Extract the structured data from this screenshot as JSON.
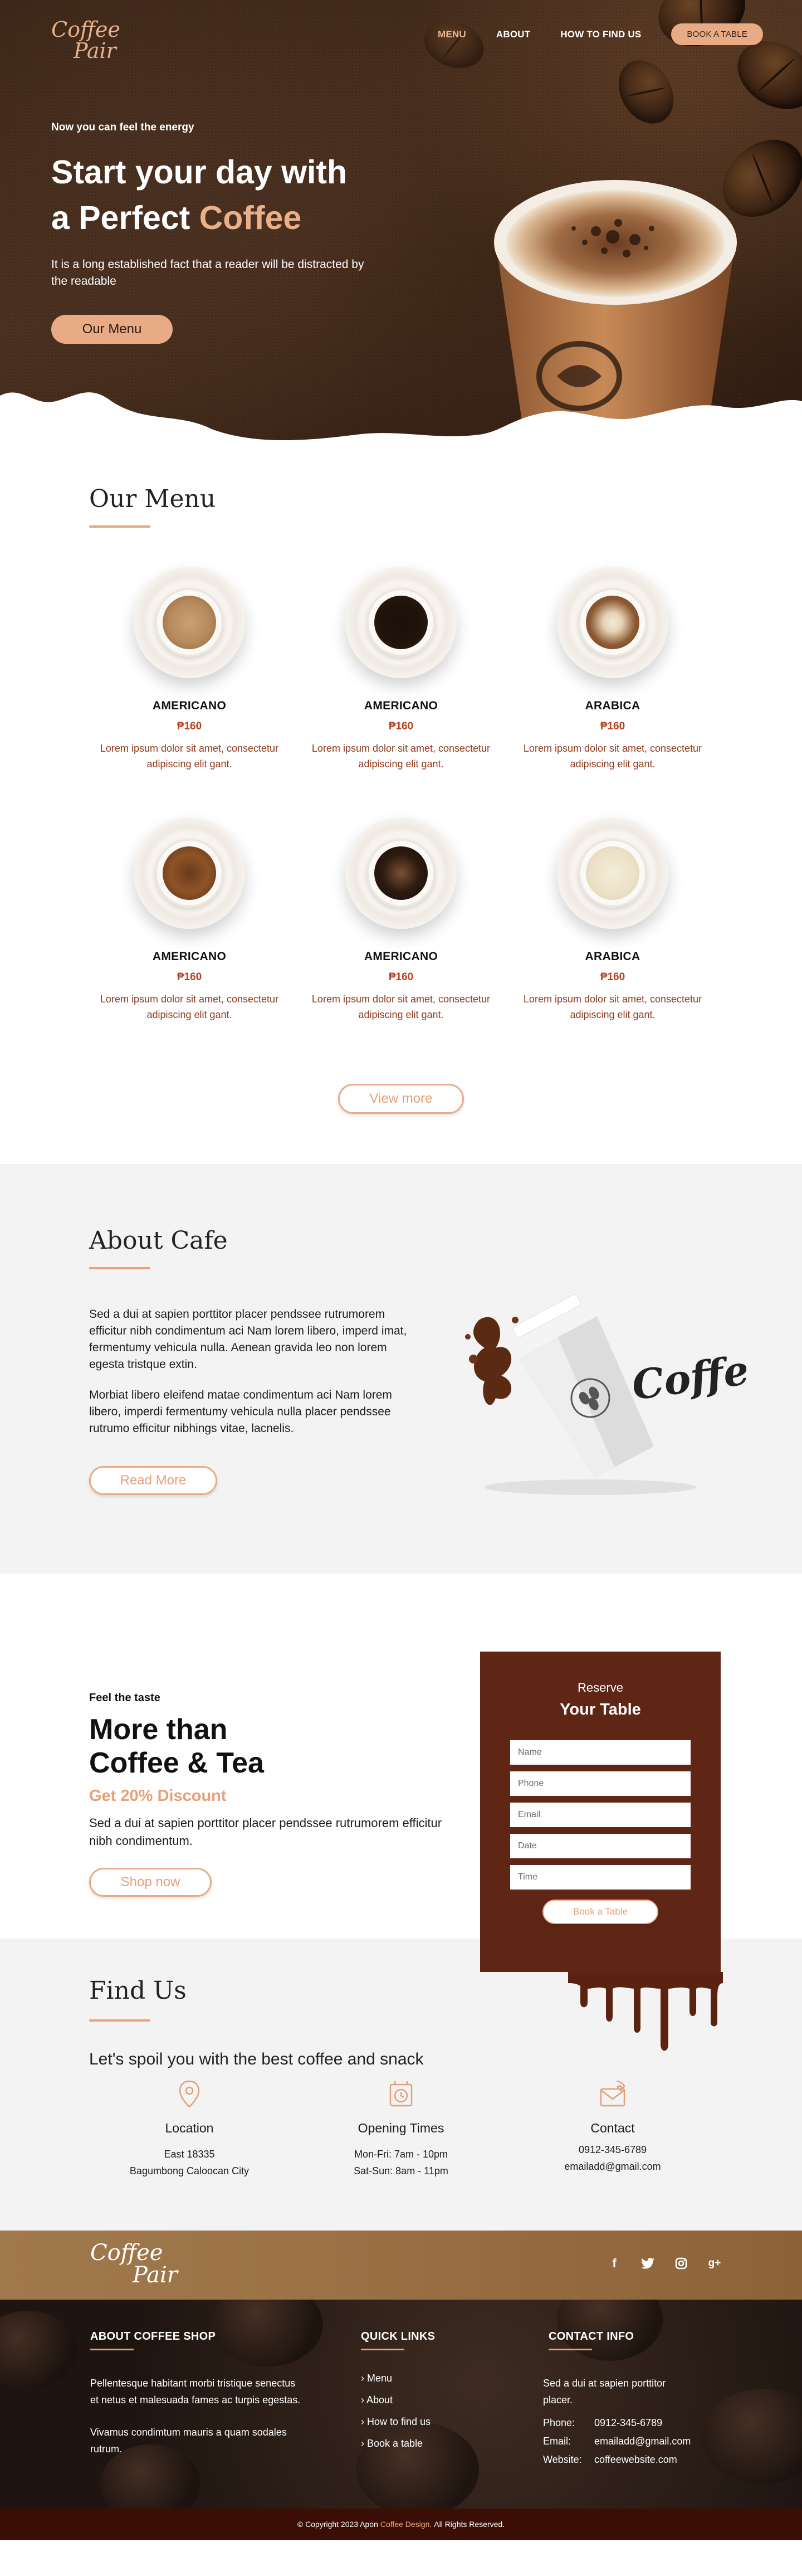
{
  "brand": {
    "logo_line1": "Coffee",
    "logo_line2": "Pair"
  },
  "nav": {
    "items": [
      "MENU",
      "ABOUT",
      "HOW TO FIND US"
    ],
    "cta": "BOOK A TABLE"
  },
  "hero": {
    "eyebrow": "Now you can feel the energy",
    "title_line1": "Start your day with",
    "title_line2_prefix": "a Perfect ",
    "title_accent": "Coffee",
    "text": "It is a long established fact that a reader will be distracted by the readable",
    "button": "Our Menu"
  },
  "menu": {
    "title": "Our Menu",
    "items": [
      {
        "name": "AMERICANO",
        "price": "₱160",
        "desc": "Lorem ipsum dolor sit amet, consectetur adipiscing elit gant."
      },
      {
        "name": "AMERICANO",
        "price": "₱160",
        "desc": "Lorem ipsum dolor sit amet, consectetur adipiscing elit gant."
      },
      {
        "name": "ARABICA",
        "price": "₱160",
        "desc": "Lorem ipsum dolor sit amet, consectetur adipiscing elit gant."
      },
      {
        "name": "AMERICANO",
        "price": "₱160",
        "desc": "Lorem ipsum dolor sit amet, consectetur adipiscing elit gant."
      },
      {
        "name": "AMERICANO",
        "price": "₱160",
        "desc": "Lorem ipsum dolor sit amet, consectetur adipiscing elit gant."
      },
      {
        "name": "ARABICA",
        "price": "₱160",
        "desc": "Lorem ipsum dolor sit amet, consectetur adipiscing elit gant."
      }
    ],
    "view_more": "View more"
  },
  "about": {
    "title": "About Cafe",
    "p1": "Sed a dui at sapien porttitor placer pendssee rutrumorem efficitur nibh condimentum aci Nam lorem libero, imperd imat, fermentumy vehicula nulla. Aenean gravida leo non lorem egesta tristque extin.",
    "p2": "Morbiat libero eleifend matae condimentum aci Nam lorem libero, imperdi fermentumy vehicula nulla placer pendssee rutrumo efficitur nibhings vitae, lacnelis.",
    "button": "Read More",
    "cup_word": "Coffee"
  },
  "reserve": {
    "eyebrow": "Feel the taste",
    "title_line1": "More than",
    "title_line2": "Coffee & Tea",
    "discount": "Get 20% Discount",
    "desc": "Sed a dui at sapien porttitor placer pendssee rutrumorem efficitur nibh condimentum.",
    "button": "Shop now",
    "form": {
      "heading1": "Reserve",
      "heading2": "Your Table",
      "placeholders": [
        "Name",
        "Phone",
        "Email",
        "Date",
        "Time"
      ],
      "submit": "Book a Table"
    }
  },
  "find": {
    "title": "Find Us",
    "subtitle": "Let's spoil you with the best coffee and snack",
    "location": {
      "title": "Location",
      "line1": "East 18335",
      "line2": "Bagumbong Caloocan City"
    },
    "hours": {
      "title": "Opening Times",
      "line1": "Mon-Fri: 7am - 10pm",
      "line2": "Sat-Sun: 8am - 11pm"
    },
    "contact": {
      "title": "Contact",
      "line1": "0912-345-6789",
      "line2": "emailadd@gmail.com"
    }
  },
  "footer": {
    "socials": [
      "facebook-icon",
      "twitter-icon",
      "instagram-icon",
      "google-plus-icon"
    ],
    "about": {
      "title": "ABOUT COFFEE SHOP",
      "p1": "Pellentesque habitant morbi tristique senectus et netus et malesuada fames ac turpis egestas.",
      "p2": "Vivamus condimtum mauris a quam sodales rutrum."
    },
    "links": {
      "title": "QUICK LINKS",
      "items": [
        "Menu",
        "About",
        "How to find us",
        "Book a table"
      ]
    },
    "contact": {
      "title": "CONTACT INFO",
      "intro": "Sed a dui at sapien porttitor placer.",
      "phone_label": "Phone:",
      "phone": "0912-345-6789",
      "email_label": "Email:",
      "email": "emailadd@gmail.com",
      "website_label": "Website:",
      "website": "coffeewebsite.com"
    },
    "copyright_prefix": "© Copyright 2023 Apon",
    "copyright_brand": "Coffee Design.",
    "copyright_suffix": "All Rights Reserved."
  },
  "colors": {
    "accent": "#e9ab86",
    "brown_dark": "#5f2616",
    "price": "#b5431e"
  }
}
